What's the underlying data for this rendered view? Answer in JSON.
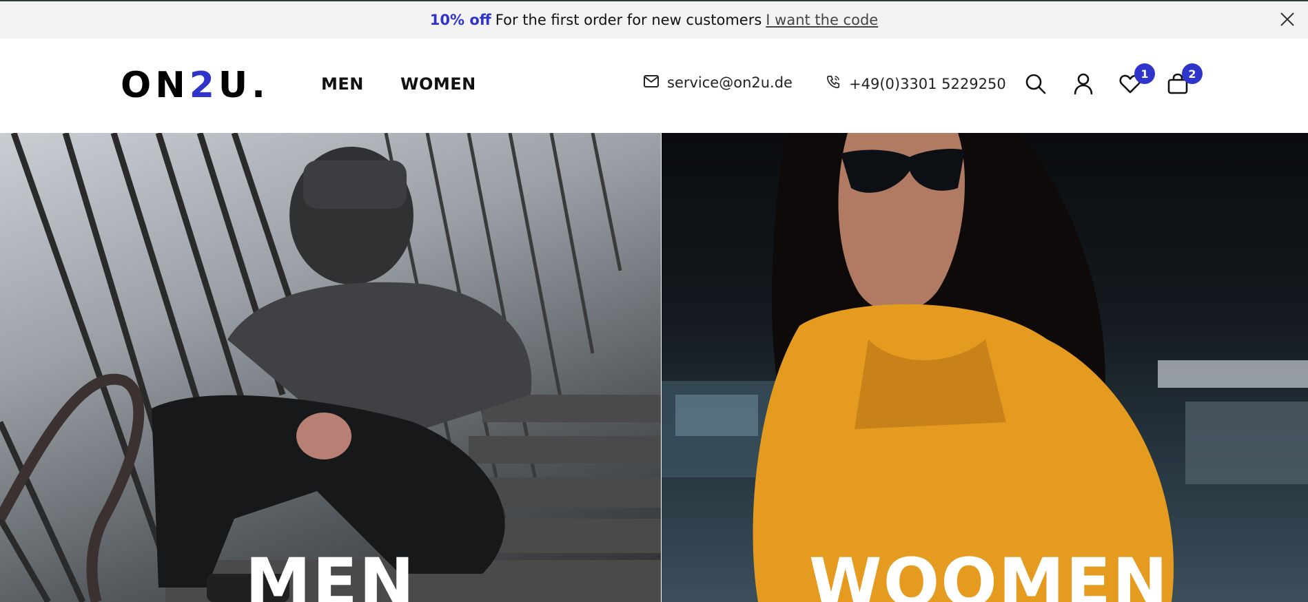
{
  "promo": {
    "discount": "10% off",
    "text": "For the first order for new customers",
    "link": "I want the code"
  },
  "header": {
    "logo": {
      "prefix": "ON",
      "accent": "2",
      "suffix": "U."
    },
    "nav": [
      {
        "label": "MEN"
      },
      {
        "label": "WOMEN"
      }
    ],
    "email": "service@on2u.de",
    "phone": "+49(0)3301 5229250",
    "wishlist_count": "1",
    "cart_count": "2"
  },
  "hero": {
    "men_label": "MEN",
    "women_label": "WOOMEN"
  },
  "colors": {
    "accent": "#2f35c8",
    "promo_bg": "#f3f3f3"
  },
  "icons": [
    "close-icon",
    "mail-icon",
    "phone-icon",
    "search-icon",
    "user-icon",
    "heart-icon",
    "bag-icon"
  ]
}
